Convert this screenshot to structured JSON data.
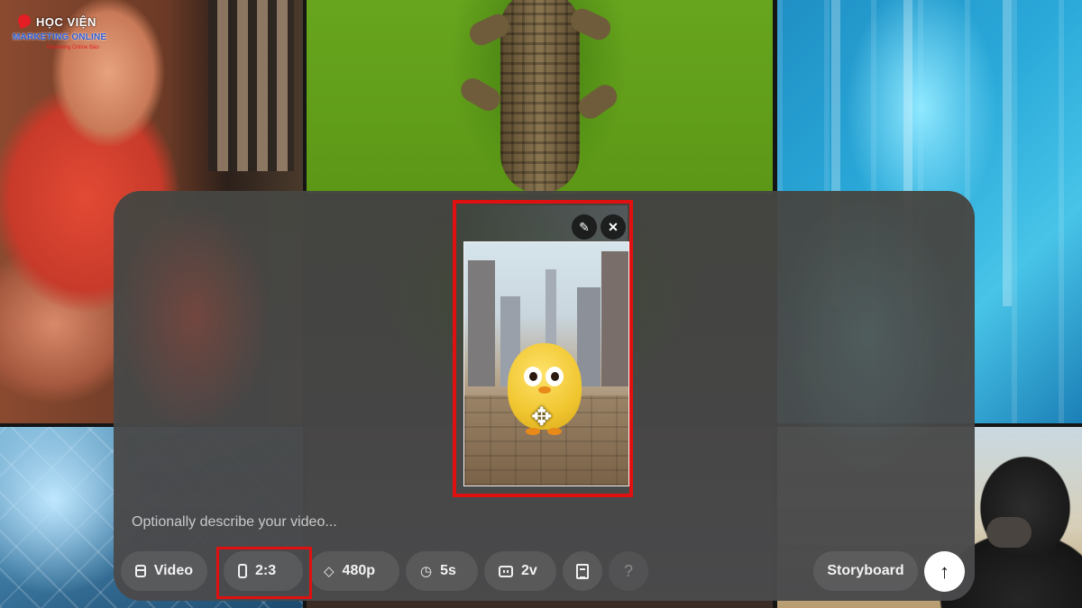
{
  "logo": {
    "line1": "HỌC VIỆN",
    "line2": "MARKETING ONLINE",
    "line3": "Marketing Online Bảo"
  },
  "composer": {
    "prompt_placeholder": "Optionally describe your video...",
    "image_actions": {
      "edit_icon": "pencil-icon",
      "remove_icon": "close-icon"
    },
    "toolbar": {
      "type_label": "Video",
      "aspect_ratio": "2:3",
      "resolution": "480p",
      "duration": "5s",
      "variations": "2v",
      "help_label": "?",
      "storyboard_label": "Storyboard",
      "submit_icon": "arrow-up-icon"
    }
  },
  "colors": {
    "highlight": "#e01010",
    "panel": "#4a4a4a",
    "submit_bg": "#ffffff"
  }
}
